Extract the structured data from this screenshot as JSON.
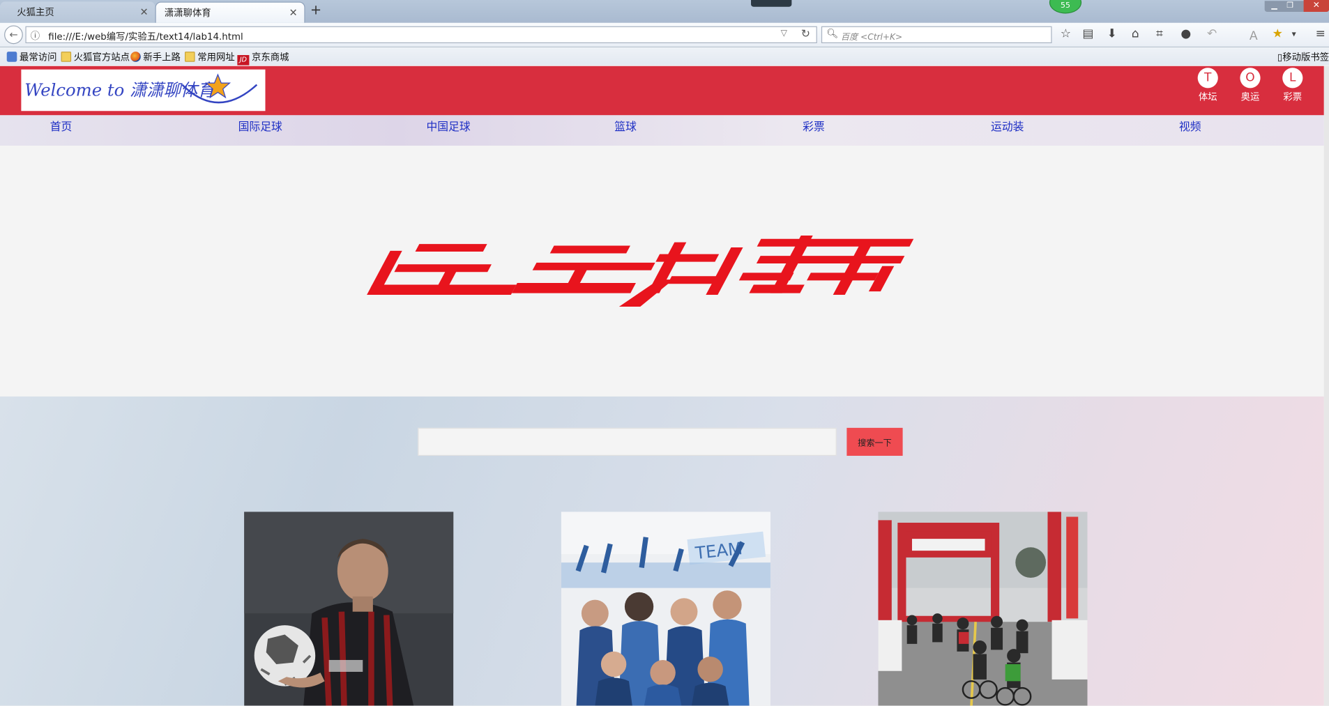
{
  "browser": {
    "tabs": [
      {
        "label": "火狐主页",
        "active": false
      },
      {
        "label": "潇潇聊体育",
        "active": true
      }
    ],
    "address": "file:///E:/web编写/实验五/text14/lab14.html",
    "search_placeholder": "百度 <Ctrl+K>",
    "badge": "55",
    "bookmarks": [
      {
        "label": "最常访问",
        "icon": "visit-icon"
      },
      {
        "label": "火狐官方站点",
        "icon": "folder-icon"
      },
      {
        "label": "新手上路",
        "icon": "firefox-icon"
      },
      {
        "label": "常用网址",
        "icon": "folder-icon"
      },
      {
        "label": "京东商城",
        "icon": "jd-icon"
      }
    ],
    "mobile_bookmarks": "移动版书签"
  },
  "page": {
    "logo_text": "Welcome to 潇潇聊体育",
    "round_links": [
      {
        "letter": "T",
        "label": "体坛"
      },
      {
        "letter": "O",
        "label": "奥运"
      },
      {
        "letter": "L",
        "label": "彩票"
      }
    ],
    "menu": [
      "首页",
      "国际足球",
      "中国足球",
      "篮球",
      "彩票",
      "运动装",
      "视频"
    ],
    "banner_text": "运动帮",
    "search": {
      "value": "",
      "button": "搜索一下"
    },
    "photos": [
      "footballer-photo",
      "cheering-fans-photo",
      "cycling-race-photo"
    ]
  },
  "colors": {
    "header_red": "#d82e3e",
    "menu_link": "#1d2ec4",
    "banner_red": "#e8141d",
    "search_button": "#ef4b51",
    "logo_blue": "#3445c2"
  }
}
